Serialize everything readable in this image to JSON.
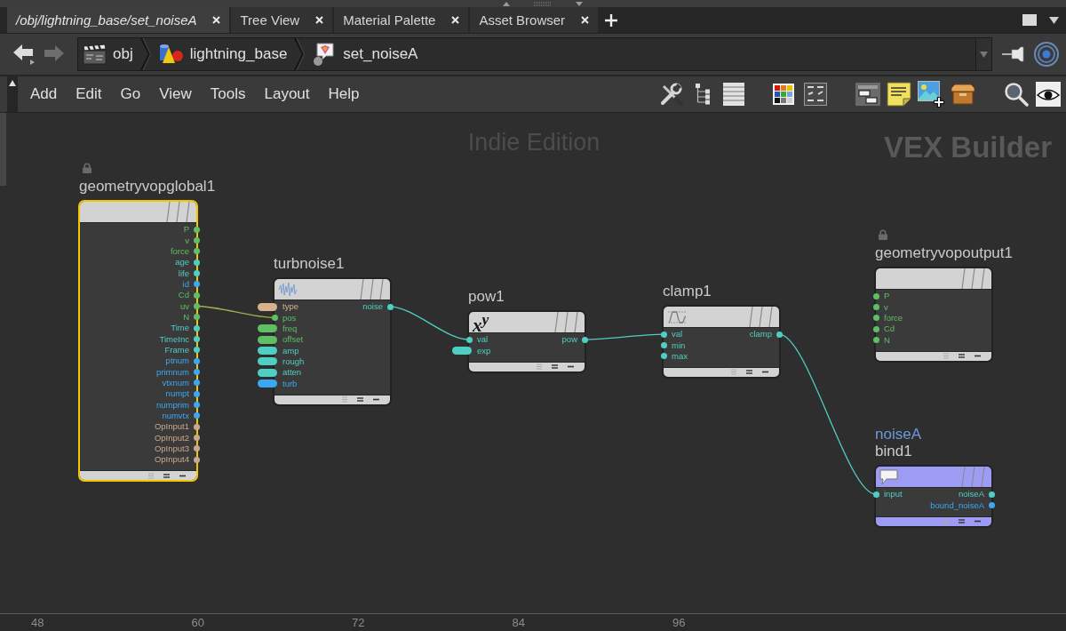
{
  "tabs": [
    {
      "label": "/obj/lightning_base/set_noiseA",
      "selected": true
    },
    {
      "label": "Tree View",
      "selected": false
    },
    {
      "label": "Material Palette",
      "selected": false
    },
    {
      "label": "Asset Browser",
      "selected": false
    }
  ],
  "path": [
    {
      "label": "obj"
    },
    {
      "label": "lightning_base"
    },
    {
      "label": "set_noiseA"
    }
  ],
  "menu": [
    "Add",
    "Edit",
    "Go",
    "View",
    "Tools",
    "Layout",
    "Help"
  ],
  "network": {
    "edition_label": "Indie Edition",
    "context_label": "VEX Builder",
    "nodes": [
      {
        "name": "geometryvopglobal1",
        "selected": true,
        "locked": true,
        "color": "#d3d3d3",
        "outputs": [
          {
            "name": "P",
            "color": "#5fbf63"
          },
          {
            "name": "v",
            "color": "#5fbf63"
          },
          {
            "name": "force",
            "color": "#5fbf63"
          },
          {
            "name": "age",
            "color": "#4fcfc3"
          },
          {
            "name": "life",
            "color": "#4fcfc3"
          },
          {
            "name": "id",
            "color": "#3aa8f2"
          },
          {
            "name": "Cd",
            "color": "#5fbf63"
          },
          {
            "name": "uv",
            "color": "#5fbf63"
          },
          {
            "name": "N",
            "color": "#5fbf63"
          },
          {
            "name": "Time",
            "color": "#4fcfc3"
          },
          {
            "name": "TimeInc",
            "color": "#4fcfc3"
          },
          {
            "name": "Frame",
            "color": "#4fcfc3"
          },
          {
            "name": "ptnum",
            "color": "#3aa8f2"
          },
          {
            "name": "primnum",
            "color": "#3aa8f2"
          },
          {
            "name": "vtxnum",
            "color": "#3aa8f2"
          },
          {
            "name": "numpt",
            "color": "#3aa8f2"
          },
          {
            "name": "numprim",
            "color": "#3aa8f2"
          },
          {
            "name": "numvtx",
            "color": "#3aa8f2"
          },
          {
            "name": "OpInput1",
            "color": "#c9a98d"
          },
          {
            "name": "OpInput2",
            "color": "#c9a98d"
          },
          {
            "name": "OpInput3",
            "color": "#c9a98d"
          },
          {
            "name": "OpInput4",
            "color": "#c9a98d"
          }
        ]
      },
      {
        "name": "turbnoise1",
        "selected": false,
        "locked": false,
        "color": "#d3d3d3",
        "inputs": [
          {
            "name": "type",
            "color": "#d9b08c",
            "kind": "pill"
          },
          {
            "name": "pos",
            "color": "#5fbf63",
            "kind": "dot"
          },
          {
            "name": "freq",
            "color": "#5fbf63",
            "kind": "pill"
          },
          {
            "name": "offset",
            "color": "#5fbf63",
            "kind": "pill"
          },
          {
            "name": "amp",
            "color": "#4fcfc3",
            "kind": "pill"
          },
          {
            "name": "rough",
            "color": "#4fcfc3",
            "kind": "pill"
          },
          {
            "name": "atten",
            "color": "#4fcfc3",
            "kind": "pill"
          },
          {
            "name": "turb",
            "color": "#3aa8f2",
            "kind": "pill"
          }
        ],
        "outputs": [
          {
            "name": "noise",
            "color": "#4fcfc3"
          }
        ]
      },
      {
        "name": "pow1",
        "selected": false,
        "locked": false,
        "color": "#d3d3d3",
        "header_glyph": "x$^{y}$",
        "inputs": [
          {
            "name": "val",
            "color": "#4fcfc3",
            "kind": "dot"
          },
          {
            "name": "exp",
            "color": "#4fcfc3",
            "kind": "pill"
          }
        ],
        "outputs": [
          {
            "name": "pow",
            "color": "#4fcfc3"
          }
        ]
      },
      {
        "name": "clamp1",
        "selected": false,
        "locked": false,
        "color": "#d3d3d3",
        "inputs": [
          {
            "name": "val",
            "color": "#4fcfc3",
            "kind": "dot"
          },
          {
            "name": "min",
            "color": "#4fcfc3",
            "kind": "dot"
          },
          {
            "name": "max",
            "color": "#4fcfc3",
            "kind": "dot"
          }
        ],
        "outputs": [
          {
            "name": "clamp",
            "color": "#4fcfc3"
          }
        ]
      },
      {
        "name": "geometryvopoutput1",
        "selected": false,
        "locked": true,
        "color": "#d3d3d3",
        "inputs": [
          {
            "name": "P",
            "color": "#5fbf63",
            "kind": "dot"
          },
          {
            "name": "v",
            "color": "#5fbf63",
            "kind": "dot"
          },
          {
            "name": "force",
            "color": "#5fbf63",
            "kind": "dot"
          },
          {
            "name": "Cd",
            "color": "#5fbf63",
            "kind": "dot"
          },
          {
            "name": "N",
            "color": "#5fbf63",
            "kind": "dot"
          }
        ]
      },
      {
        "name": "bind1",
        "selected": false,
        "locked": false,
        "color": "#9e9bf5",
        "parm_label": "noiseA",
        "inputs": [
          {
            "name": "input",
            "color": "#4fcfc3",
            "kind": "dot"
          }
        ],
        "outputs": [
          {
            "name": "noiseA",
            "color": "#4fcfc3"
          },
          {
            "name": "bound_noiseA",
            "color": "#3aa8f2"
          }
        ]
      }
    ]
  },
  "ruler": [
    "48",
    "60",
    "72",
    "84",
    "96"
  ]
}
